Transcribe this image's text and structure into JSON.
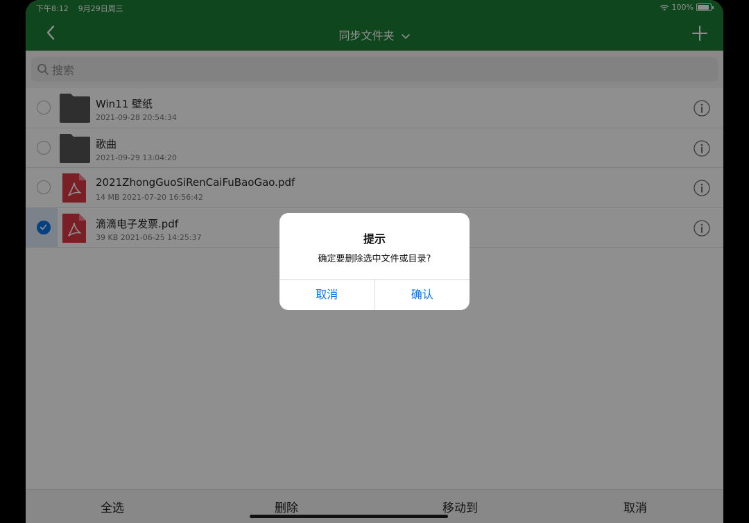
{
  "status": {
    "time": "下午8:12",
    "date": "9月29日周三",
    "battery": "100%"
  },
  "nav": {
    "title": "同步文件夹"
  },
  "search": {
    "placeholder": "搜索"
  },
  "files": [
    {
      "name": "Win11 壁纸",
      "meta": "2021-09-28 20:54:34",
      "type": "folder",
      "selected": false
    },
    {
      "name": "歌曲",
      "meta": "2021-09-29 13:04:20",
      "type": "folder",
      "selected": false
    },
    {
      "name": "2021ZhongGuoSiRenCaiFuBaoGao.pdf",
      "meta": "14 MB 2021-07-20 16:56:42",
      "type": "pdf",
      "selected": false
    },
    {
      "name": "滴滴电子发票.pdf",
      "meta": "39 KB 2021-06-25 14:25:37",
      "type": "pdf",
      "selected": true
    }
  ],
  "toolbar": {
    "select_all": "全选",
    "delete": "删除",
    "move_to": "移动到",
    "cancel": "取消"
  },
  "dialog": {
    "title": "提示",
    "message": "确定要删除选中文件或目录?",
    "cancel": "取消",
    "confirm": "确认"
  },
  "colors": {
    "nav": "#1e7e34",
    "accent": "#0a73e8",
    "pdf": "#d93843"
  }
}
